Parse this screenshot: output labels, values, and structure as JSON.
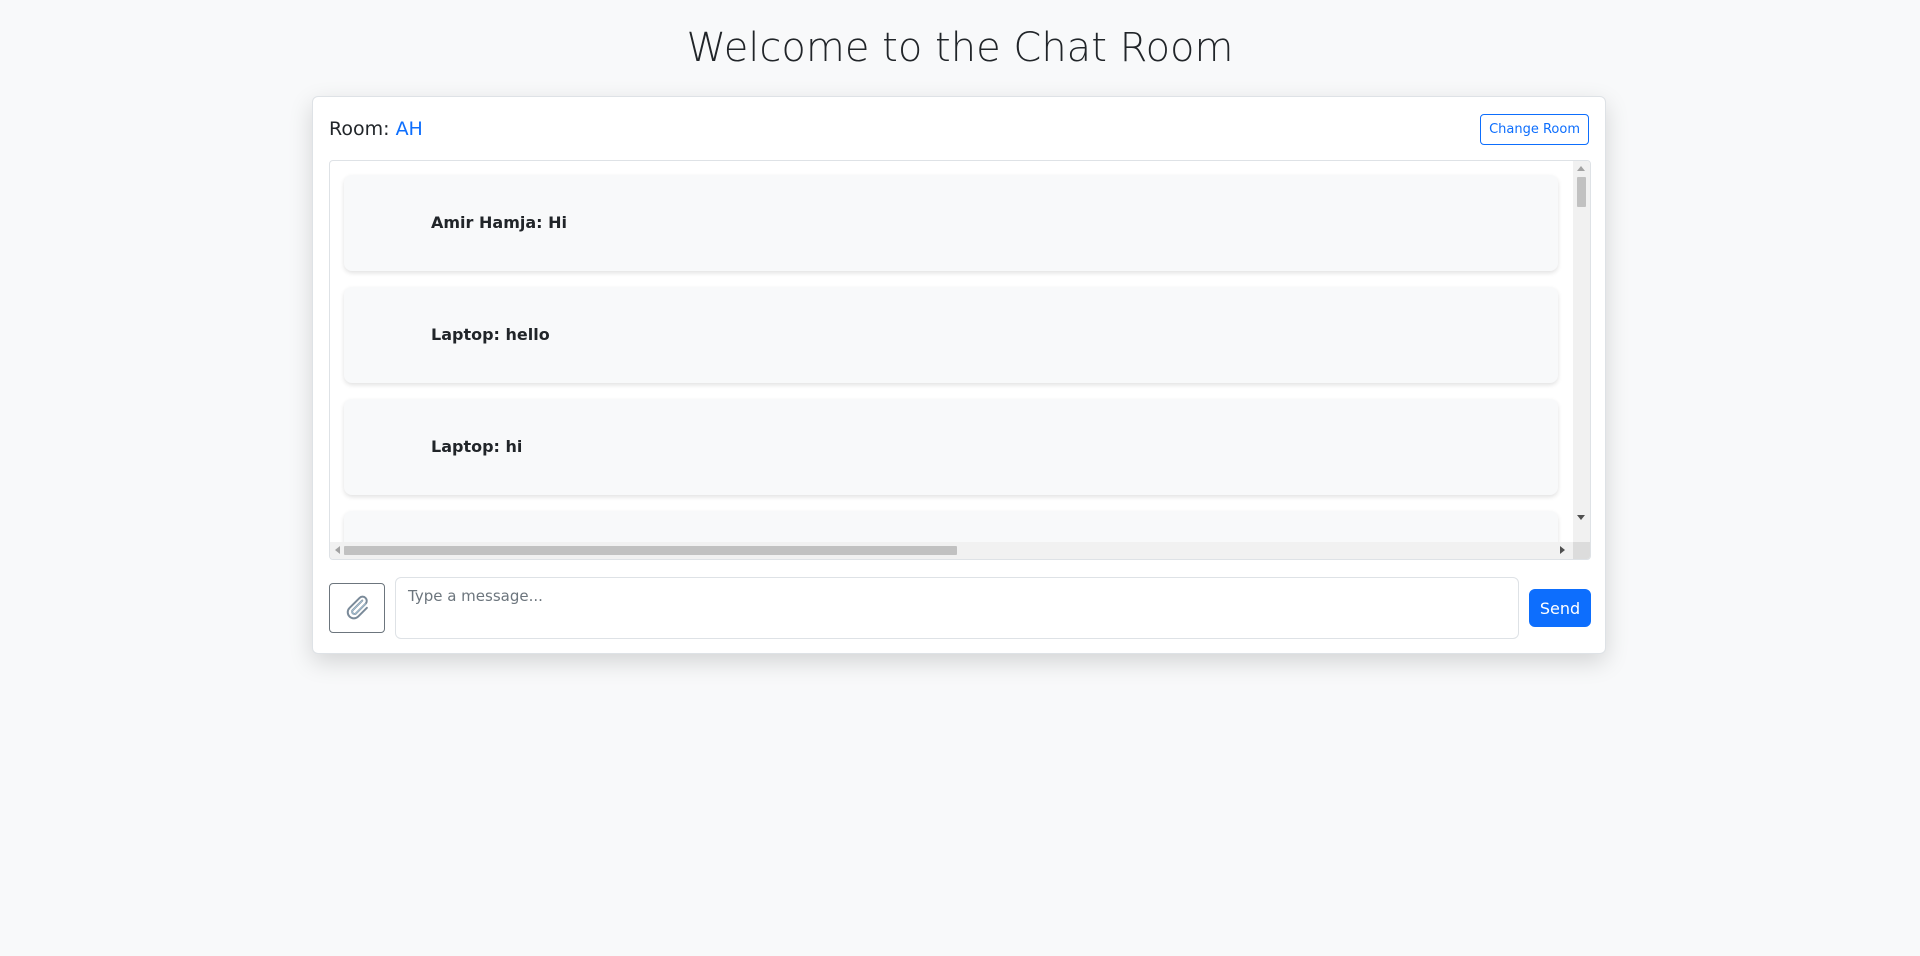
{
  "header": {
    "title": "Welcome to the Chat Room"
  },
  "room": {
    "label": "Room:",
    "name": "AH",
    "change_button": "Change Room"
  },
  "messages": [
    {
      "text": "Amir Hamja: Hi"
    },
    {
      "text": "Laptop: hello"
    },
    {
      "text": "Laptop: hi"
    },
    {
      "text": ""
    }
  ],
  "composer": {
    "placeholder": "Type a message...",
    "value": "",
    "attach_icon": "paperclip-icon",
    "send_label": "Send"
  },
  "colors": {
    "accent": "#0d6efd",
    "background": "#f8f9fa"
  }
}
